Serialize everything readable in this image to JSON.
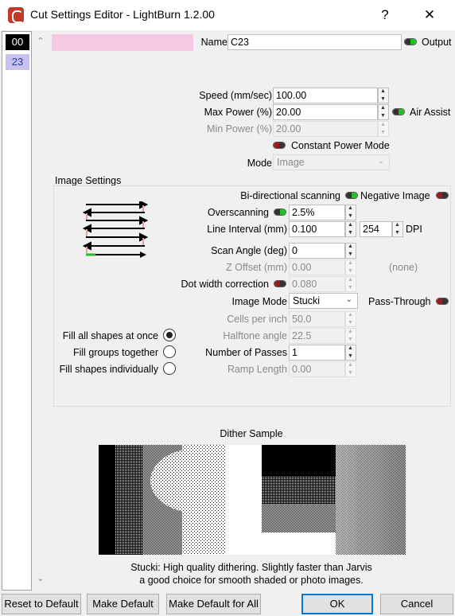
{
  "window": {
    "title": "Cut Settings Editor - LightBurn 1.2.00",
    "help_glyph": "?",
    "close_glyph": "✕",
    "icon": "lightburn-app-icon"
  },
  "layers": [
    {
      "label": "00",
      "color": "#000000"
    },
    {
      "label": "23",
      "color": "#c9c2f0"
    }
  ],
  "swatch_color": "#f7c8e3",
  "header": {
    "name_label": "Name",
    "name_value": "C23",
    "output_label": "Output"
  },
  "speed": {
    "label": "Speed (mm/sec)",
    "value": "100.00"
  },
  "max_power": {
    "label": "Max Power (%)",
    "value": "20.00"
  },
  "air_assist": {
    "label": "Air Assist"
  },
  "min_power": {
    "label": "Min Power (%)",
    "value": "20.00"
  },
  "constant_power": {
    "label": "Constant Power Mode"
  },
  "mode": {
    "label": "Mode",
    "value": "Image"
  },
  "image_settings": {
    "title": "Image Settings",
    "bidirectional": "Bi-directional scanning",
    "negative_image": "Negative Image",
    "overscanning": {
      "label": "Overscanning",
      "value": "2.5%"
    },
    "line_interval": {
      "label": "Line Interval (mm)",
      "value": "0.100",
      "dpi_value": "254",
      "dpi_label": "DPI"
    },
    "scan_angle": {
      "label": "Scan Angle (deg)",
      "value": "0"
    },
    "z_offset": {
      "label": "Z Offset (mm)",
      "value": "0.00",
      "note": "(none)"
    },
    "dot_width": {
      "label": "Dot width correction",
      "value": "0.080"
    },
    "image_mode": {
      "label": "Image Mode",
      "value": "Stucki"
    },
    "pass_through": "Pass-Through",
    "cells_per_inch": {
      "label": "Cells per inch",
      "value": "50.0"
    },
    "halftone_angle": {
      "label": "Halftone angle",
      "value": "22.5"
    },
    "num_passes": {
      "label": "Number of Passes",
      "value": "1"
    },
    "ramp_length": {
      "label": "Ramp Length",
      "value": "0.00"
    },
    "fill_all": "Fill all shapes at once",
    "fill_groups": "Fill groups together",
    "fill_individually": "Fill shapes individually"
  },
  "dither": {
    "title": "Dither Sample",
    "desc_line1": "Stucki: High quality dithering. Slightly faster than Jarvis",
    "desc_line2": "a good choice for smooth shaded or photo images."
  },
  "footer": {
    "reset": "Reset to Default",
    "make_default": "Make Default",
    "make_default_all": "Make Default for All",
    "ok": "OK",
    "cancel": "Cancel"
  },
  "colors": {
    "toggle_on": "#22c022",
    "toggle_off": "#9b1b1b",
    "swatch": "#f7c8e3",
    "accent": "#0078d7"
  }
}
